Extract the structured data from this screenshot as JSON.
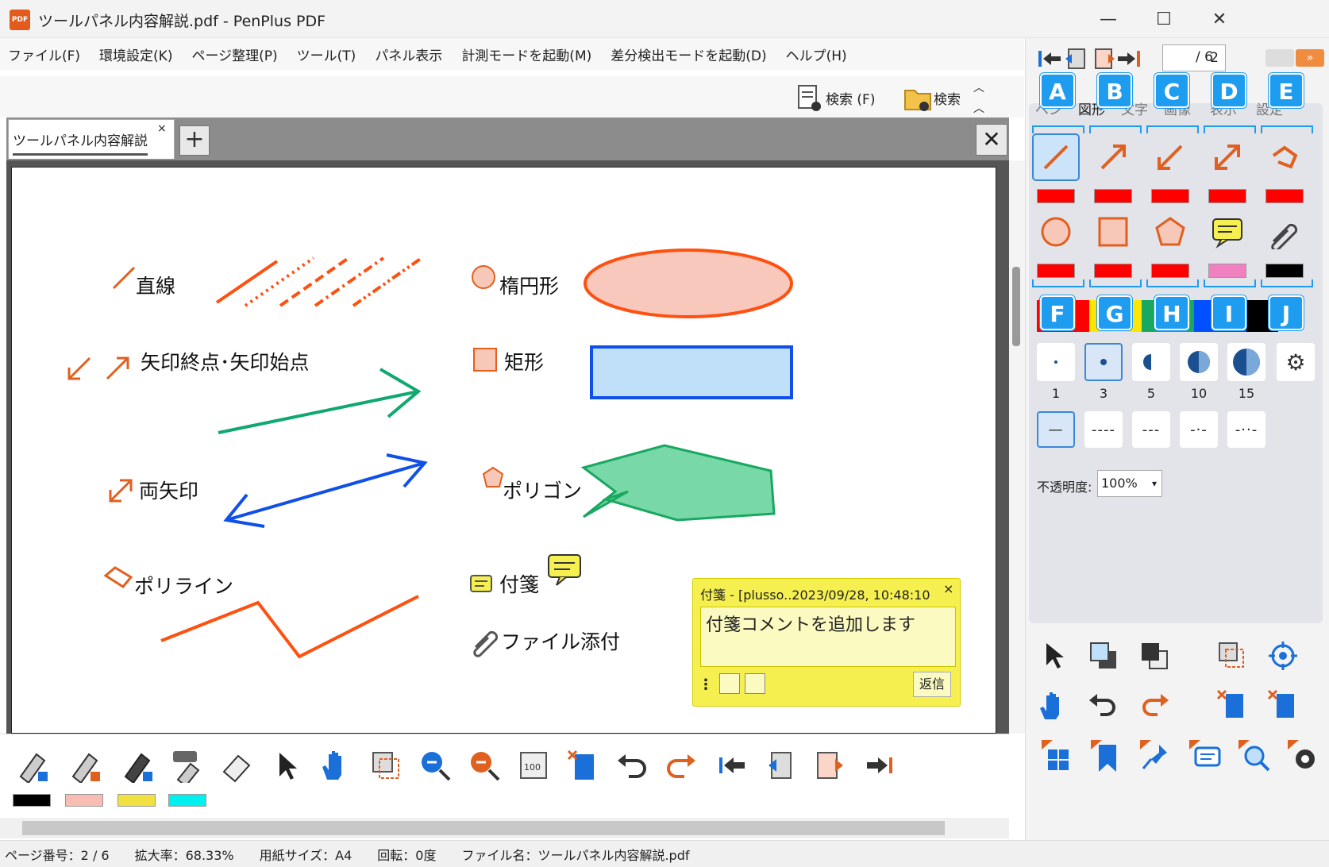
{
  "window": {
    "title": "ツールパネル内容解説.pdf - PenPlus PDF",
    "logo": "PDF",
    "minimize": "—",
    "maximize": "☐",
    "close": "✕"
  },
  "menu": [
    "ファイル(F)",
    "環境設定(K)",
    "ページ整理(P)",
    "ツール(T)",
    "パネル表示",
    "計測モードを起動(M)",
    "差分検出モードを起動(D)",
    "ヘルプ(H)"
  ],
  "search": {
    "file_search": "検索 (F)",
    "folder_search": "検索"
  },
  "tab": {
    "label": "ツールパネル内容解説",
    "close": "×",
    "add": "+",
    "close_doc": "✕"
  },
  "page_labels": {
    "line": "直線",
    "arrow": "矢印終点･矢印始点",
    "double_arrow": "両矢印",
    "polyline": "ポリライン",
    "ellipse": "楕円形",
    "rect": "矩形",
    "polygon": "ポリゴン",
    "note": "付箋",
    "attach": "ファイル添付"
  },
  "sticky": {
    "header": "付箋 - [plusso..2023/09/28, 10:48:10",
    "close": "×",
    "body": "付箋コメントを追加します",
    "reply": "返信"
  },
  "bottom_swatches": [
    "#000000",
    "#f7bcb2",
    "#f0e040",
    "#00f0f0"
  ],
  "status": {
    "page": "ページ番号：2 / 6",
    "zoom": "拡大率：68.33%",
    "paper": "用紙サイズ：A4",
    "rotation": "回転：0度",
    "filename": "ファイル名：ツールパネル内容解説.pdf"
  },
  "nav": {
    "current_page": "2",
    "total": "/ 6"
  },
  "panel_tabs": [
    "ペン",
    "図形",
    "文字",
    "画像",
    "表示",
    "設定"
  ],
  "badges_top": [
    "A",
    "B",
    "C",
    "D",
    "E"
  ],
  "badges_bottom": [
    "F",
    "G",
    "H",
    "I",
    "J"
  ],
  "row1_colors": [
    "#ff0000",
    "#ff0000",
    "#ff0000",
    "#ff0000",
    "#ff0000"
  ],
  "row2_colors": [
    "#ff0000",
    "#ff0000",
    "#ff0000",
    "#f080c0",
    "#000000"
  ],
  "palette_colors": [
    "#ff0000",
    "#ffe600",
    "#18a860",
    "#0050ff",
    "#000000"
  ],
  "sizes": [
    "1",
    "3",
    "5",
    "10",
    "15"
  ],
  "dashes": [
    "—",
    "----",
    "---",
    "-·-",
    "-··-"
  ],
  "opacity": {
    "label": "不透明度:",
    "value": "100%"
  }
}
